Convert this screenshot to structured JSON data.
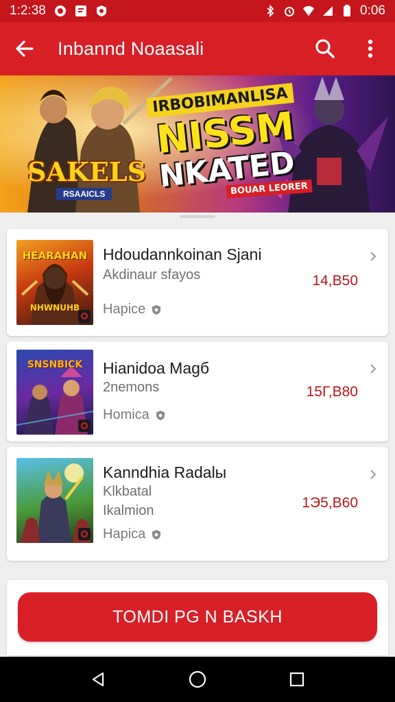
{
  "status_bar": {
    "time": "1:2:38",
    "clock": "0:06"
  },
  "app_bar": {
    "title": "Inbannd Noaasali"
  },
  "banner": {
    "logo_text": "SAKELS",
    "logo_sub": "RSAAICLS",
    "headline_top": "IRBOBIMANLISA",
    "headline_big1": "NISSM",
    "headline_big2": "NKATED",
    "headline_sub": "BOUAR LEORER"
  },
  "items": [
    {
      "name": "Hdoudannkoinan Sjani",
      "sub1": "Akdinaur sfayos",
      "sub2": "",
      "tag": "Hapice",
      "price": "14,B50",
      "thumb_title": "HEARAHAN",
      "thumb_sub": "NHWNUHB"
    },
    {
      "name": "Hianidoa Magб",
      "sub1": "2nemons",
      "sub2": "",
      "tag": "Homica",
      "price": "15Г,B80",
      "thumb_title": "SNSNBICK",
      "thumb_sub": ""
    },
    {
      "name": "Kanndhia Radalы",
      "sub1": "Klkbatal",
      "sub2": "Ikalmion",
      "tag": "Hapica",
      "price": "1Э5,B60",
      "thumb_title": "",
      "thumb_sub": ""
    }
  ],
  "cta": {
    "label": "TOMDI PG N BASKH"
  },
  "colors": {
    "primary": "#d81f26",
    "status": "#c4161c",
    "price": "#b9141a"
  }
}
